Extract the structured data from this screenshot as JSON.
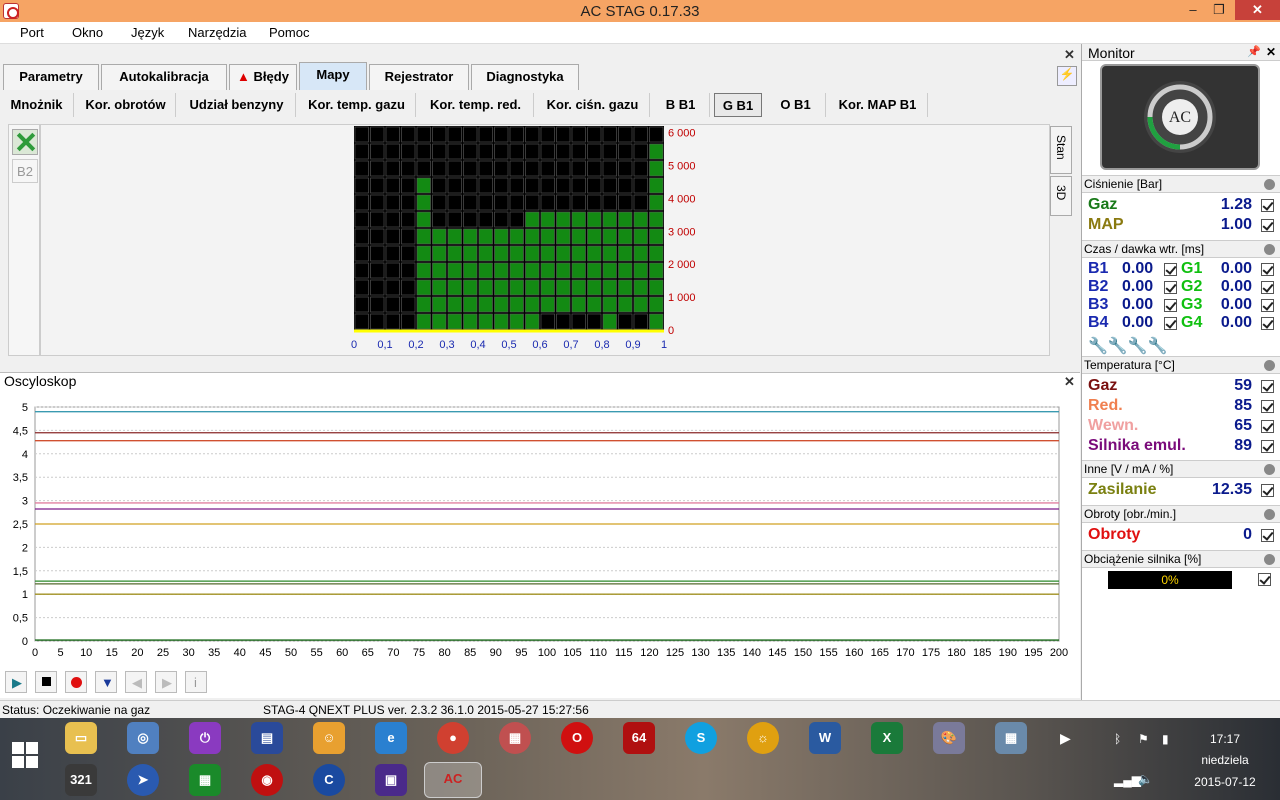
{
  "window": {
    "title": "AC STAG 0.17.33",
    "minimize": "‒",
    "restore": "❐",
    "close": "✕"
  },
  "menu": [
    "Port",
    "Okno",
    "Język",
    "Narzędzia",
    "Pomoc"
  ],
  "main_tabs": [
    {
      "label": "Parametry"
    },
    {
      "label": "Autokalibracja"
    },
    {
      "label": "Błędy"
    },
    {
      "label": "Mapy"
    },
    {
      "label": "Rejestrator"
    },
    {
      "label": "Diagnostyka"
    }
  ],
  "sub_tabs": [
    {
      "label": "Mnożnik"
    },
    {
      "label": "Kor. obrotów"
    },
    {
      "label": "Udział benzyny"
    },
    {
      "label": "Kor. temp. gazu"
    },
    {
      "label": "Kor. temp. red."
    },
    {
      "label": "Kor. ciśn. gazu"
    },
    {
      "label": "B B1"
    },
    {
      "label": "G B1"
    },
    {
      "label": "O B1"
    },
    {
      "label": "Kor. MAP B1"
    }
  ],
  "map_side": {
    "b2_label": "B2",
    "vtab_stan": "Stan",
    "vtab_3d": "3D"
  },
  "map_chart": {
    "x_ticks": [
      "0",
      "0,1",
      "0,2",
      "0,3",
      "0,4",
      "0,5",
      "0,6",
      "0,7",
      "0,8",
      "0,9",
      "1"
    ],
    "y_ticks": [
      "0",
      "1 000",
      "2 000",
      "3 000",
      "4 000",
      "5 000",
      "6 000"
    ],
    "cols": 20,
    "rows": 12,
    "heights": [
      0,
      0,
      0,
      0,
      4,
      7,
      7,
      7,
      7,
      7,
      7,
      7,
      7,
      7,
      7,
      7,
      7,
      7,
      7,
      11
    ],
    "tops": [
      0,
      0,
      0,
      0,
      9,
      7,
      7,
      7,
      7,
      7,
      7,
      7,
      7,
      7,
      7,
      7,
      7,
      7,
      7,
      11
    ],
    "fill_levels": [
      0,
      0,
      0,
      0,
      9,
      6,
      6,
      6,
      6,
      6,
      6,
      7,
      7,
      7,
      7,
      7,
      7,
      7,
      7,
      11
    ],
    "bottom_gaps": [
      0,
      0,
      0,
      0,
      0,
      0,
      0,
      0,
      0,
      0,
      0,
      0,
      1,
      1,
      1,
      1,
      0,
      1,
      1,
      0
    ],
    "colors": {
      "bg": "#000000",
      "cell": "#138a13",
      "grid": "#606060",
      "y_label": "#c00000",
      "x_label": "#1a2ab0",
      "baseline": "#ffff00"
    }
  },
  "oscilloscope": {
    "title": "Oscyloskop",
    "y_ticks": [
      "0",
      "0,5",
      "1",
      "1,5",
      "2",
      "2,5",
      "3",
      "3,5",
      "4",
      "4,5",
      "5"
    ],
    "x_ticks": [
      "0",
      "5",
      "10",
      "15",
      "20",
      "25",
      "30",
      "35",
      "40",
      "45",
      "50",
      "55",
      "60",
      "65",
      "70",
      "75",
      "80",
      "85",
      "90",
      "95",
      "100",
      "105",
      "110",
      "115",
      "120",
      "125",
      "130",
      "135",
      "140",
      "145",
      "150",
      "155",
      "160",
      "165",
      "170",
      "175",
      "180",
      "185",
      "190",
      "195",
      "200"
    ],
    "lines": [
      {
        "value": 4.9,
        "color": "#3a9ab0"
      },
      {
        "value": 4.45,
        "color": "#8a2a2a"
      },
      {
        "value": 4.28,
        "color": "#d05030"
      },
      {
        "value": 2.95,
        "color": "#e080a0"
      },
      {
        "value": 2.82,
        "color": "#7a1a8a"
      },
      {
        "value": 2.5,
        "color": "#d0a020"
      },
      {
        "value": 1.28,
        "color": "#2a8a2a"
      },
      {
        "value": 1.22,
        "color": "#556b2f"
      },
      {
        "value": 1.0,
        "color": "#a09020"
      },
      {
        "value": 0.02,
        "color": "#1a6a1a"
      }
    ]
  },
  "status": {
    "left": "Status: Oczekiwanie na gaz",
    "right": "STAG-4 QNEXT PLUS  ver. 2.3.2  36.1.0   2015-05-27 15:27:56"
  },
  "monitor": {
    "title": "Monitor",
    "sections": {
      "pressure": "Ciśnienie [Bar]",
      "injection": "Czas / dawka wtr. [ms]",
      "temperature": "Temperatura [°C]",
      "other": "Inne [V / mA / %]",
      "rpm": "Obroty [obr./min.]",
      "load": "Obciążenie silnika [%]"
    },
    "pressure": [
      {
        "label": "Gaz",
        "value": "1.28",
        "color": "#1a7a1a"
      },
      {
        "label": "MAP",
        "value": "1.00",
        "color": "#8a7a10"
      }
    ],
    "injectors": [
      {
        "b": "B1",
        "bv": "0.00",
        "g": "G1",
        "gv": "0.00"
      },
      {
        "b": "B2",
        "bv": "0.00",
        "g": "G2",
        "gv": "0.00"
      },
      {
        "b": "B3",
        "bv": "0.00",
        "g": "G3",
        "gv": "0.00"
      },
      {
        "b": "B4",
        "bv": "0.00",
        "g": "G4",
        "gv": "0.00"
      }
    ],
    "temps": [
      {
        "label": "Gaz",
        "value": "59",
        "color": "#7a1010"
      },
      {
        "label": "Red.",
        "value": "85",
        "color": "#f08050"
      },
      {
        "label": "Wewn.",
        "value": "65",
        "color": "#f0a0a0"
      },
      {
        "label": "Silnika emul.",
        "value": "89",
        "color": "#7a0a7a"
      }
    ],
    "supply": {
      "label": "Zasilanie",
      "value": "12.35",
      "color": "#7a8010"
    },
    "rpm": {
      "label": "Obroty",
      "value": "0",
      "color": "#e01010"
    },
    "load": {
      "value": "0%"
    }
  },
  "tray": {
    "time": "17:17",
    "day": "niedziela",
    "date": "2015-07-12"
  }
}
